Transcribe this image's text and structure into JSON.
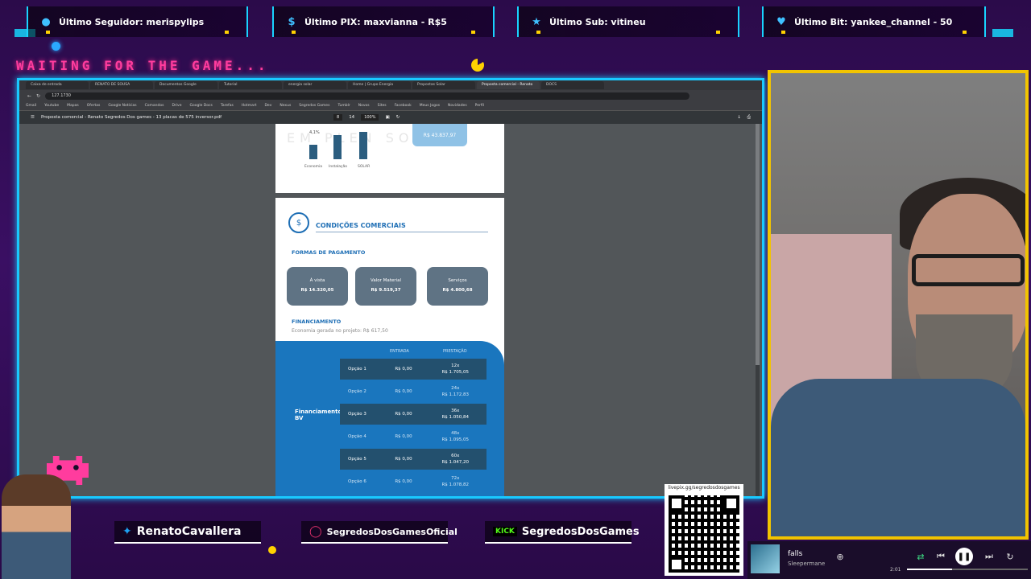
{
  "alerts": [
    {
      "icon": "user-icon",
      "label": "Último Seguidor: merispylips"
    },
    {
      "icon": "pix-diamond-icon",
      "label": "Último PIX: maxvianna - R$5"
    },
    {
      "icon": "star-icon",
      "label": "Último Sub: vitineu"
    },
    {
      "icon": "heart-gem-icon",
      "label": "Último Bit: yankee_channel - 50"
    }
  ],
  "waiting_text": "WAITING FOR THE GAME...",
  "browser": {
    "tabs": [
      "Caixa de entrada",
      "RENATO DE SOUSA",
      "Documentos Google",
      "Tutorial",
      "energia solar",
      "Home | Grupo Energia",
      "Propostas Solar",
      "Proposta comercial - Renato",
      "DOCS"
    ],
    "address": "127.1730",
    "bookmarks": [
      "Gmail",
      "Youtube",
      "Mapas",
      "Ofertas",
      "Google Notícias",
      "Comandos",
      "Drive",
      "Google Docs",
      "Tarefas",
      "Hotmart",
      "Dev",
      "Nexus",
      "Segredos Games",
      "Tumblr",
      "Novos",
      "Sites",
      "Facebook",
      "Meus Jogos",
      "Novidades",
      "Perfil"
    ],
    "pdf_title": "Proposta comercial - Renato Segredos Dos games - 13 placas de 575 inversor.pdf",
    "page_current": "8",
    "page_total": "14",
    "zoom": "100%"
  },
  "pdf": {
    "page1": {
      "pct": "4,1%",
      "categories": [
        "Economia",
        "Instalação",
        "SOLAR"
      ],
      "econ_box": "R$ 43.837,97"
    },
    "section_title": "CONDIÇÕES COMERCIAIS",
    "formas_title": "FORMAS DE PAGAMENTO",
    "payments": [
      {
        "label": "À vista",
        "value": "R$ 14.320,05"
      },
      {
        "label": "Valor Material",
        "value": "R$ 9.519,37"
      },
      {
        "label": "Serviços",
        "value": "R$ 4.800,68"
      }
    ],
    "financiamento_title": "FINANCIAMENTO",
    "economia_line": "Economia gerada no projeto: R$ 617,50",
    "col_entrada": "ENTRADA",
    "col_prestacao": "PRESTAÇÃO",
    "fin_label": "Financiamento BV",
    "options": [
      {
        "op": "Opção 1",
        "entrada": "R$ 0,00",
        "parc": "12x",
        "valor": "R$ 1.705,05"
      },
      {
        "op": "Opção 2",
        "entrada": "R$ 0,00",
        "parc": "24x",
        "valor": "R$ 1.172,83"
      },
      {
        "op": "Opção 3",
        "entrada": "R$ 0,00",
        "parc": "36x",
        "valor": "R$ 1.050,84"
      },
      {
        "op": "Opção 4",
        "entrada": "R$ 0,00",
        "parc": "48x",
        "valor": "R$ 1.095,05"
      },
      {
        "op": "Opção 5",
        "entrada": "R$ 0,00",
        "parc": "60x",
        "valor": "R$ 1.047,20"
      },
      {
        "op": "Opção 6",
        "entrada": "R$ 0,00",
        "parc": "72x",
        "valor": "R$ 1.078,82"
      }
    ]
  },
  "socials": [
    {
      "icon": "twitter-bird-icon",
      "label": "RenatoCavallera"
    },
    {
      "icon": "instagram-icon",
      "label": "SegredosDosGamesOficial"
    },
    {
      "icon": "kick-icon",
      "label": "KICK",
      "handle": "SegredosDosGames"
    }
  ],
  "qr": {
    "url": "livepix.gg/segredosdosgames"
  },
  "player": {
    "title": "falls",
    "artist": "Sleepermane",
    "time": "2:01"
  },
  "colors": {
    "accent": "#19c9ff",
    "cam_border": "#f2c400",
    "waiting": "#ff3c9e",
    "pdf_blue": "#1a76be"
  }
}
